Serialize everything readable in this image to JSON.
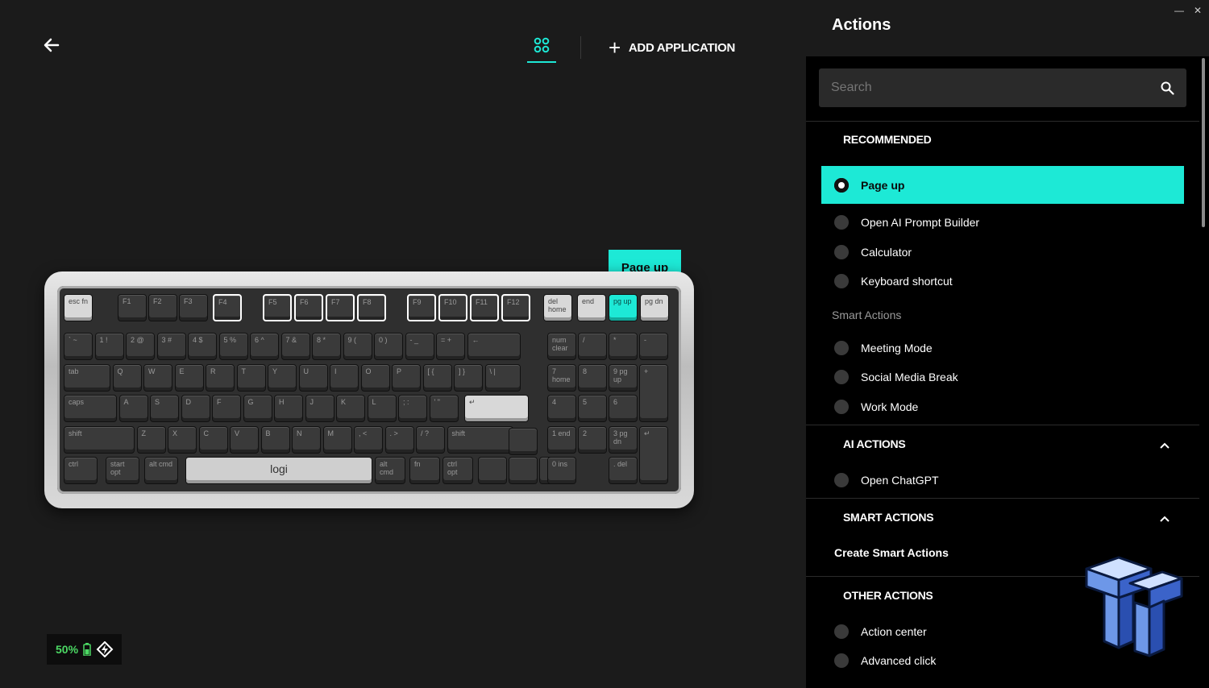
{
  "header": {
    "add_application": "ADD APPLICATION"
  },
  "keyboard": {
    "tooltip": "Page up",
    "space_label": "logi",
    "rows": [
      [
        "` ~",
        "1 !",
        "2 @",
        "3 #",
        "4 $",
        "5 %",
        "6 ^",
        "7 &",
        "8 *",
        "9 (",
        "0 )",
        "- _",
        "= +",
        "←"
      ],
      [
        "tab",
        "Q",
        "W",
        "E",
        "R",
        "T",
        "Y",
        "U",
        "I",
        "O",
        "P",
        "[ {",
        "] }",
        "\\ |"
      ],
      [
        "caps",
        "A",
        "S",
        "D",
        "F",
        "G",
        "H",
        "J",
        "K",
        "L",
        "; :",
        "' \""
      ],
      [
        "shift",
        "Z",
        "X",
        "C",
        "V",
        "B",
        "N",
        "M",
        ", <",
        ". >",
        "/ ?",
        "shift"
      ]
    ],
    "bottom": [
      "ctrl",
      "start opt",
      "alt cmd",
      "alt cmd",
      "fn",
      "ctrl opt"
    ],
    "fn_row": [
      "esc fn",
      "F1",
      "F2",
      "F3",
      "F4",
      "F5",
      "F6",
      "F7",
      "F8",
      "F9",
      "F10",
      "F11",
      "F12",
      "del home",
      "end",
      "pg up",
      "pg dn"
    ],
    "numpad": [
      "num clear",
      "/",
      "*",
      "-",
      "7 home",
      "8",
      "9 pg up",
      "+",
      "4",
      "5",
      "6",
      "1 end",
      "2",
      "3 pg dn",
      "0 ins",
      ". del"
    ]
  },
  "status": {
    "battery": "50%"
  },
  "panel": {
    "title": "Actions",
    "search_placeholder": "Search",
    "recommended": {
      "title": "RECOMMENDED",
      "items": [
        "Page up",
        "Open AI Prompt Builder",
        "Calculator",
        "Keyboard shortcut"
      ],
      "subheading": "Smart Actions",
      "smart_items": [
        "Meeting Mode",
        "Social Media Break",
        "Work Mode"
      ]
    },
    "ai_actions": {
      "title": "AI ACTIONS",
      "items": [
        "Open ChatGPT"
      ]
    },
    "smart_actions": {
      "title": "SMART ACTIONS",
      "create": "Create Smart Actions"
    },
    "other_actions": {
      "title": "OTHER ACTIONS",
      "items": [
        "Action center",
        "Advanced click"
      ]
    }
  },
  "colors": {
    "accent": "#1de9d6",
    "battery": "#4cd964",
    "background": "#1b1b1b",
    "panel": "#000000"
  }
}
